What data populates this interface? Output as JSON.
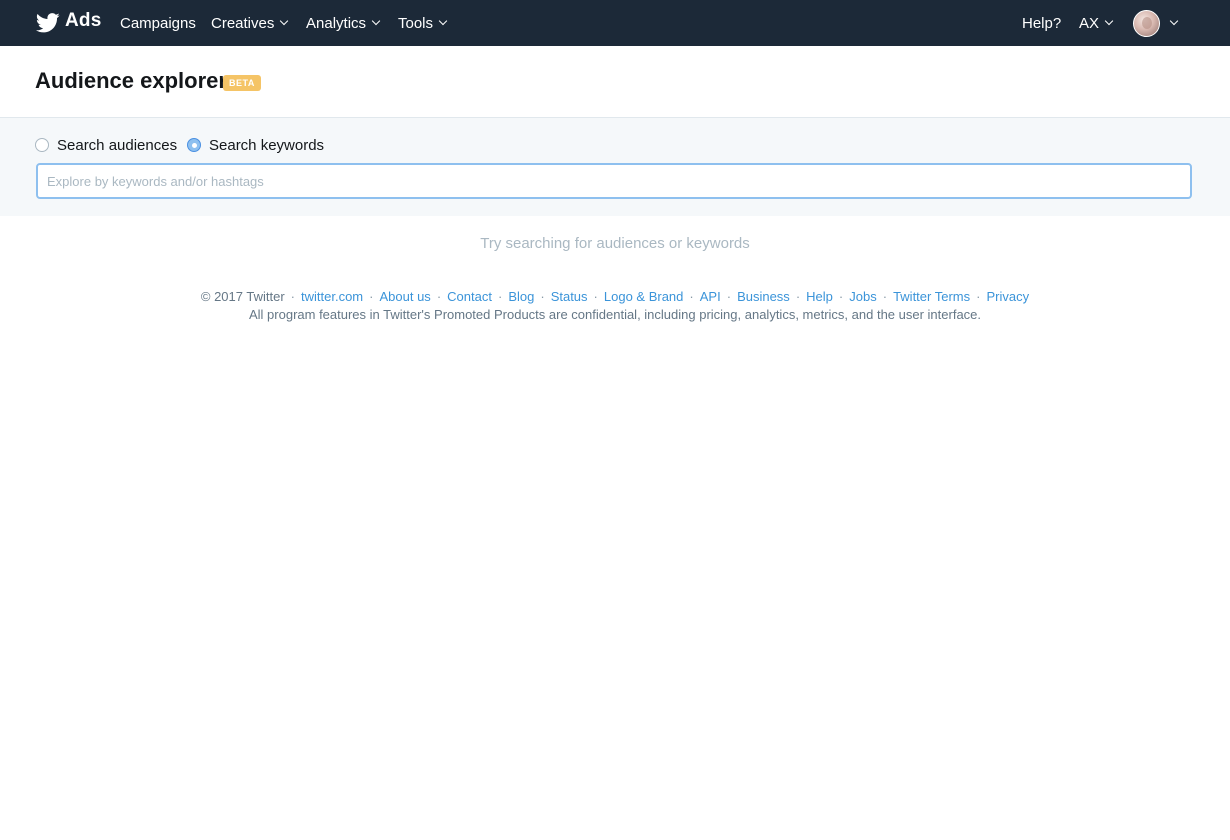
{
  "nav": {
    "brand_label": "Ads",
    "campaigns": "Campaigns",
    "creatives": "Creatives",
    "analytics": "Analytics",
    "tools": "Tools",
    "help": "Help?",
    "account": "AX",
    "brand_color": "#1c2938"
  },
  "header": {
    "title": "Audience explorer",
    "badge": "BETA",
    "badge_color": "#f5c466"
  },
  "search": {
    "option_audiences": "Search audiences",
    "option_keywords": "Search keywords",
    "selected": "keywords",
    "input_value": "",
    "placeholder": "Explore by keywords and/or hashtags"
  },
  "empty_state": "Try searching for audiences or keywords",
  "footer": {
    "copyright": "© 2017 Twitter",
    "links": [
      "twitter.com",
      "About us",
      "Contact",
      "Blog",
      "Status",
      "Logo & Brand",
      "API",
      "Business",
      "Help",
      "Jobs",
      "Twitter Terms",
      "Privacy"
    ],
    "disclaimer": "All program features in Twitter's Promoted Products are confidential, including pricing, analytics, metrics, and the user interface.",
    "link_color": "#3b94d9"
  },
  "icons": {
    "brand": "twitter-bird-icon",
    "dropdown": "chevron-down-icon",
    "avatar": "user-avatar"
  }
}
